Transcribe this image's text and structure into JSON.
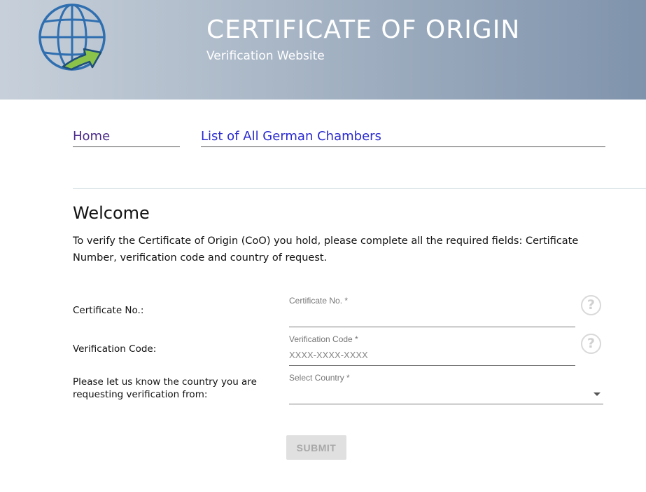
{
  "header": {
    "logo_icon": "globe-arrow-icon",
    "title": "CERTIFICATE OF ORIGIN",
    "subtitle": "Verification Website"
  },
  "nav": {
    "items": [
      {
        "label": "Home"
      },
      {
        "label": "List of All German Chambers"
      }
    ]
  },
  "main": {
    "heading": "Welcome",
    "intro": "To verify the Certificate of Origin (CoO) you hold, please complete all the required fields: Certificate Number, verification code and country of request."
  },
  "form": {
    "certificate": {
      "row_label": "Certificate No.:",
      "field_label": "Certificate No. *",
      "value": "",
      "placeholder": "",
      "help_icon": "question-circle-icon"
    },
    "verification": {
      "row_label": "Verification Code:",
      "field_label": "Verification Code *",
      "value": "",
      "placeholder": "XXXX-XXXX-XXXX",
      "help_icon": "question-circle-icon"
    },
    "country": {
      "row_label": "Please let us know the country you are requesting verification from:",
      "field_label": "Select Country *",
      "value": "",
      "dropdown_icon": "caret-down-icon"
    },
    "submit_label": "SUBMIT"
  },
  "colors": {
    "header_gradient_start": "#c7d0da",
    "header_gradient_end": "#7f93ac",
    "nav_home": "#4b2a8a",
    "nav_link": "#2a2ad0",
    "submit_bg": "#e0e0e0"
  }
}
